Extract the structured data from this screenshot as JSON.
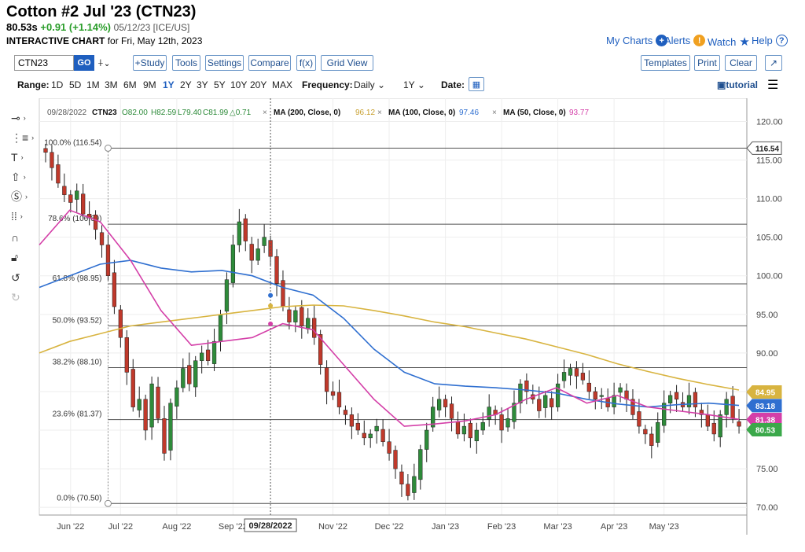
{
  "header": {
    "title": "Cotton #2 Jul '23 (CTN23)",
    "last": "80.53s",
    "change": "+0.91 (+1.14%)",
    "quote_meta": "05/12/23 [ICE/US]",
    "subtitle_bold": "INTERACTIVE CHART",
    "subtitle_rest": "for Fri, May 12th, 2023"
  },
  "top_links": {
    "my_charts": "My Charts",
    "alerts": "Alerts",
    "watch": "Watch",
    "help": "Help"
  },
  "toolbar": {
    "symbol": "CTN23",
    "go": "GO",
    "study": "+Study",
    "tools": "Tools",
    "settings": "Settings",
    "compare": "Compare",
    "fx": "f(x)",
    "grid_view": "Grid View",
    "templates": "Templates",
    "print": "Print",
    "clear": "Clear"
  },
  "range_bar": {
    "range_label": "Range:",
    "ranges": [
      "1D",
      "5D",
      "1M",
      "3M",
      "6M",
      "9M",
      "1Y",
      "2Y",
      "3Y",
      "5Y",
      "10Y",
      "20Y",
      "MAX"
    ],
    "active_range": "1Y",
    "frequency_label": "Frequency:",
    "frequency": "Daily",
    "period": "1Y",
    "date_label": "Date:",
    "tutorial": "tutorial"
  },
  "legend": {
    "date": "09/28/2022",
    "symbol": "CTN23",
    "open": "O82.00",
    "high": "H82.59",
    "low": "L79.40",
    "close": "C81.99",
    "change": "△0.71",
    "ma200_label": "MA (200, Close, 0)",
    "ma200_value": "96.12",
    "ma100_label": "MA (100, Close, 0)",
    "ma100_value": "97.46",
    "ma50_label": "MA (50, Close, 0)",
    "ma50_value": "93.77"
  },
  "colors": {
    "up": "#2e8b3a",
    "down": "#c0392b",
    "ma200": "#d8b440",
    "ma100": "#2f6fd0",
    "ma50": "#d43fa8",
    "last_badge": "#3aa84a"
  },
  "chart_data": {
    "type": "candlestick",
    "ylim": [
      69,
      123
    ],
    "y_ticks": [
      "70.00",
      "75.00",
      "80.00",
      "85.00",
      "90.00",
      "95.00",
      "100.00",
      "105.00",
      "110.00",
      "115.00",
      "120.00"
    ],
    "x_tick_labels": [
      "Jun '22",
      "Jul '22",
      "Aug '22",
      "Sep '22",
      "Nov '22",
      "Dec '22",
      "Jan '23",
      "Feb '23",
      "Mar '23",
      "Apr '23",
      "May '23"
    ],
    "crosshair_date": "09/28/2022",
    "fibonacci": [
      {
        "label": "100.0% (116.54)",
        "value": 116.54
      },
      {
        "label": "78.6% (106.69)",
        "value": 106.69
      },
      {
        "label": "61.8% (98.95)",
        "value": 98.95
      },
      {
        "label": "50.0% (93.52)",
        "value": 93.52
      },
      {
        "label": "38.2% (88.10)",
        "value": 88.1
      },
      {
        "label": "23.6% (81.37)",
        "value": 81.37
      },
      {
        "label": "0.0% (70.50)",
        "value": 70.5
      }
    ],
    "price_badges": {
      "high_line": "116.54",
      "ma200": "84.95",
      "ma100": "83.18",
      "ma50": "81.38",
      "last": "80.53"
    },
    "close_series": {
      "name": "CTN23",
      "values": [
        116.0,
        114.0,
        112.0,
        110.5,
        109.5,
        111.0,
        108.0,
        107.5,
        106.0,
        104.0,
        100.0,
        96.0,
        92.0,
        87.5,
        83.0,
        84.0,
        80.0,
        86.0,
        81.5,
        77.0,
        83.5,
        85.5,
        88.0,
        86.0,
        89.0,
        90.0,
        89.0,
        91.5,
        95.0,
        99.5,
        104.0,
        107.0,
        104.5,
        102.0,
        103.5,
        105.0,
        102.5,
        99.0,
        96.0,
        94.0,
        95.5,
        93.5,
        94.5,
        92.0,
        88.5,
        85.0,
        84.5,
        83.0,
        82.0,
        80.5,
        80.0,
        79.0,
        79.5,
        80.5,
        78.5,
        77.0,
        75.0,
        73.0,
        71.5,
        74.0,
        77.5,
        80.0,
        83.0,
        84.0,
        83.0,
        81.5,
        79.5,
        80.5,
        79.0,
        80.0,
        81.0,
        83.0,
        82.0,
        80.0,
        81.5,
        83.5,
        86.0,
        85.0,
        84.0,
        82.5,
        84.5,
        83.0,
        86.0,
        87.5,
        88.0,
        87.0,
        86.5,
        85.0,
        84.0,
        84.5,
        83.0,
        84.5,
        85.5,
        84.0,
        82.0,
        80.5,
        79.5,
        78.0,
        81.0,
        83.5,
        84.5,
        84.0,
        83.0,
        84.5,
        83.0,
        82.0,
        80.5,
        79.5,
        82.0,
        84.0,
        81.5,
        80.5
      ]
    },
    "ma200": [
      90.0,
      91.5,
      92.5,
      93.5,
      94.0,
      94.5,
      95.0,
      95.5,
      96.0,
      96.2,
      96.1,
      95.5,
      94.8,
      94.0,
      93.4,
      92.6,
      91.8,
      90.8,
      89.8,
      88.6,
      87.6,
      86.7,
      85.9,
      85.2
    ],
    "ma100": [
      98.5,
      100.0,
      101.5,
      102.0,
      101.0,
      100.5,
      100.7,
      100.0,
      98.5,
      97.5,
      94.5,
      90.5,
      87.5,
      86.0,
      85.7,
      85.5,
      85.2,
      84.8,
      84.0,
      83.4,
      83.0,
      83.3,
      83.5,
      83.2
    ],
    "ma50": [
      104.0,
      108.5,
      107.0,
      102.0,
      95.5,
      91.0,
      91.5,
      92.0,
      93.8,
      93.0,
      88.5,
      84.0,
      80.5,
      80.8,
      81.2,
      82.0,
      84.0,
      85.5,
      83.5,
      84.5,
      83.0,
      82.5,
      82.0,
      81.4
    ]
  }
}
